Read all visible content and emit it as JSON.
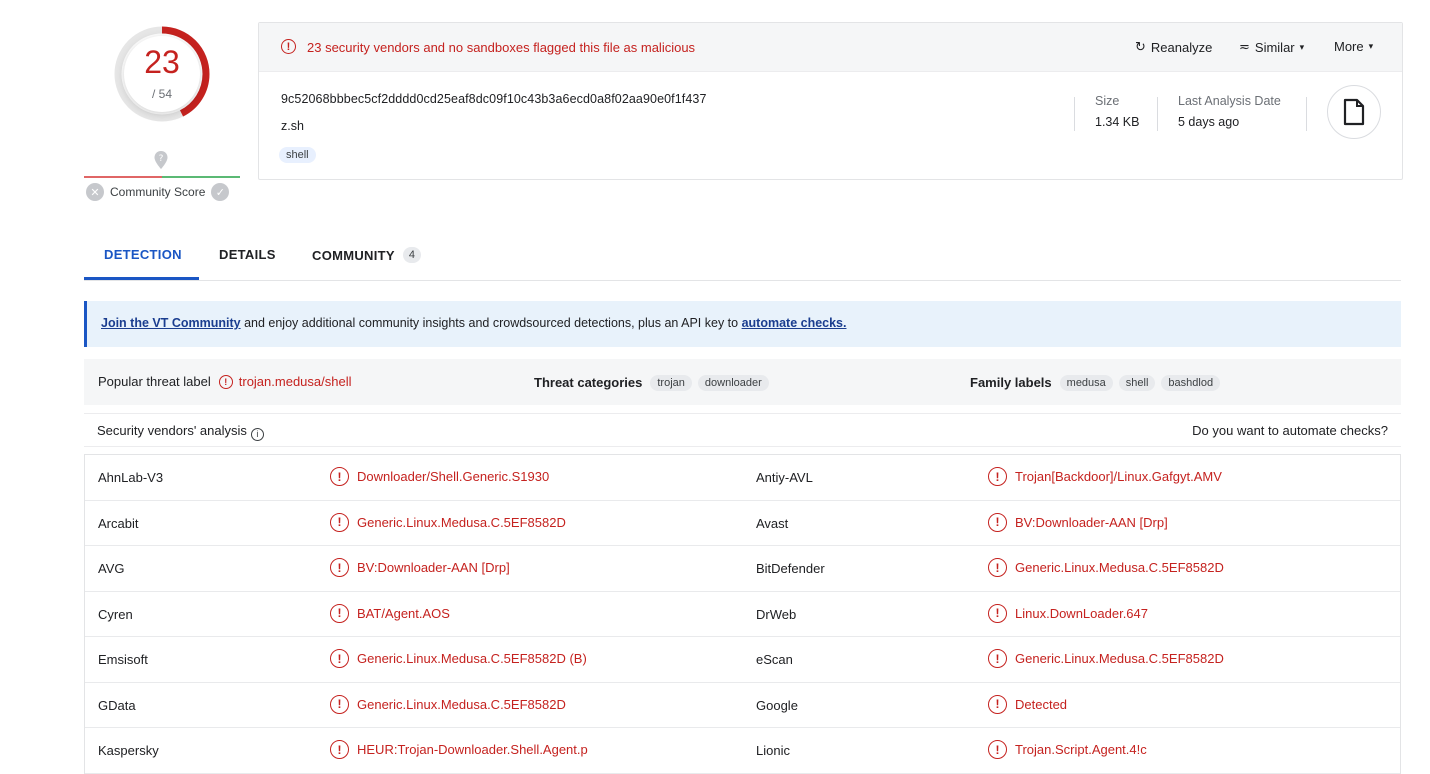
{
  "score": {
    "detections": "23",
    "total": "/ 54",
    "community_label": "Community Score"
  },
  "alert": {
    "text": "23 security vendors and no sandboxes flagged this file as malicious"
  },
  "actions": {
    "reanalyze": "Reanalyze",
    "similar": "Similar",
    "more": "More"
  },
  "file": {
    "hash": "9c52068bbbec5cf2dddd0cd25eaf8dc09f10c43b3a6ecd0a8f02aa90e0f1f437",
    "name": "z.sh",
    "tag": "shell",
    "size_label": "Size",
    "size_value": "1.34 KB",
    "date_label": "Last Analysis Date",
    "date_value": "5 days ago"
  },
  "tabs": [
    {
      "label": "DETECTION"
    },
    {
      "label": "DETAILS"
    },
    {
      "label": "COMMUNITY",
      "count": "4"
    }
  ],
  "banner": {
    "link1": "Join the VT Community",
    "middle": " and enjoy additional community insights and crowdsourced detections, plus an API key to ",
    "link2": "automate checks."
  },
  "threat": {
    "popular_label": "Popular threat label",
    "popular_value": "trojan.medusa/shell",
    "categories_label": "Threat categories",
    "categories": [
      "trojan",
      "downloader"
    ],
    "family_label": "Family labels",
    "families": [
      "medusa",
      "shell",
      "bashdlod"
    ]
  },
  "vendors_header": {
    "title": "Security vendors' analysis",
    "cta": "Do you want to automate checks?"
  },
  "vendors": [
    {
      "v1": "AhnLab-V3",
      "r1": "Downloader/Shell.Generic.S1930",
      "v2": "Antiy-AVL",
      "r2": "Trojan[Backdoor]/Linux.Gafgyt.AMV"
    },
    {
      "v1": "Arcabit",
      "r1": "Generic.Linux.Medusa.C.5EF8582D",
      "v2": "Avast",
      "r2": "BV:Downloader-AAN [Drp]"
    },
    {
      "v1": "AVG",
      "r1": "BV:Downloader-AAN [Drp]",
      "v2": "BitDefender",
      "r2": "Generic.Linux.Medusa.C.5EF8582D"
    },
    {
      "v1": "Cyren",
      "r1": "BAT/Agent.AOS",
      "v2": "DrWeb",
      "r2": "Linux.DownLoader.647"
    },
    {
      "v1": "Emsisoft",
      "r1": "Generic.Linux.Medusa.C.5EF8582D (B)",
      "v2": "eScan",
      "r2": "Generic.Linux.Medusa.C.5EF8582D"
    },
    {
      "v1": "GData",
      "r1": "Generic.Linux.Medusa.C.5EF8582D",
      "v2": "Google",
      "r2": "Detected"
    },
    {
      "v1": "Kaspersky",
      "r1": "HEUR:Trojan-Downloader.Shell.Agent.p",
      "v2": "Lionic",
      "r2": "Trojan.Script.Agent.4!c"
    }
  ],
  "colors": {
    "malicious": "#c5221f",
    "accent": "#1a56c4",
    "gauge_track": "#e6e6e6"
  }
}
